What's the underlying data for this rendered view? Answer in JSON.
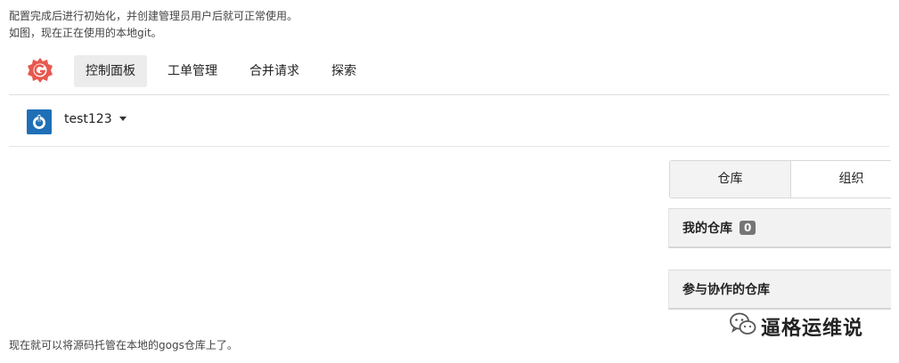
{
  "intro": {
    "line1": "配置完成后进行初始化，并创建管理员用户后就可正常使用。",
    "line2": "如图，现在正在使用的本地git。"
  },
  "nav": {
    "items": [
      "控制面板",
      "工单管理",
      "合并请求",
      "探索"
    ]
  },
  "user": {
    "name": "test123"
  },
  "tabs": [
    "仓库",
    "组织"
  ],
  "panels": {
    "my_repos": {
      "title": "我的仓库",
      "count": "0"
    },
    "collab": {
      "title": "参与协作的仓库"
    }
  },
  "outro": "现在就可以将源码托管在本地的gogs仓库上了。",
  "watermark": "逼格运维说",
  "colors": {
    "logo": "#e8584f",
    "avatar": "#1f6fb7",
    "badge": "#767676",
    "active_nav": "#ececec"
  }
}
